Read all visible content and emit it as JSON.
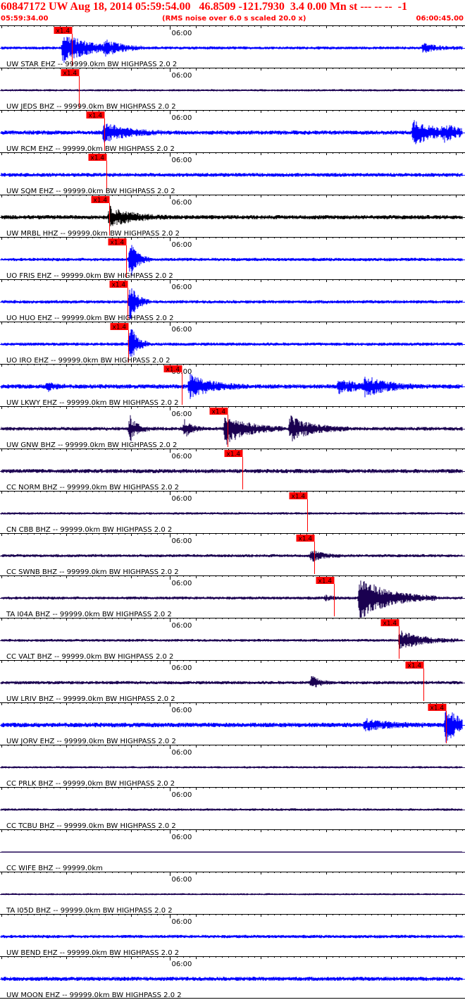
{
  "header": {
    "title": "60847172 UW Aug 18, 2014 05:59:54.00   46.8509 -121.7930  3.4 0.00 Mn st --- -- --  -1",
    "subtitle": "(RMS noise over 6.0 s scaled 20.0 x)",
    "time_start": "05:59:34.00",
    "time_end": "06:00:45.00"
  },
  "colors": {
    "blue_trace": "#0000ff",
    "dark_trace": "#1a0050",
    "black_trace": "#000000",
    "pick": "#ff0000",
    "grid": "#000000"
  },
  "chart_data": {
    "type": "line",
    "x_range_seconds": [
      0,
      71
    ],
    "minute_mark_label": "06:00",
    "minute_mark_seconds": 26,
    "pick_label": "x1.4",
    "traces": [
      {
        "label": "UW STAR EHZ -- 99999.0km BW  HIGHPASS  2.0  2",
        "color": "blue",
        "pick": 10.9,
        "noise": 2.2,
        "events": [
          {
            "t": 9.5,
            "a": 20,
            "w": 4
          },
          {
            "t": 16,
            "a": 7,
            "w": 2
          },
          {
            "t": 65,
            "a": 6,
            "w": 2
          }
        ]
      },
      {
        "label": "UW JEDS BHZ -- 99999.0km BW  HIGHPASS  2.0  2",
        "color": "dark",
        "pick": 11.9,
        "noise": 1.6,
        "events": []
      },
      {
        "label": "UW RCM EHZ -- 99999.0km BW  HIGHPASS  2.0  2",
        "color": "blue",
        "pick": 15.8,
        "noise": 3.0,
        "events": [
          {
            "t": 15.8,
            "a": 14,
            "w": 3
          },
          {
            "t": 63.5,
            "a": 18,
            "w": 3
          },
          {
            "t": 68,
            "a": 9,
            "w": 2
          }
        ]
      },
      {
        "label": "UW SQM EHZ -- 99999.0km BW  HIGHPASS  2.0  2",
        "color": "blue",
        "pick": 16.2,
        "noise": 2.8,
        "events": []
      },
      {
        "label": "UW MRBL HHZ -- 99999.0km BW  HIGHPASS  2.0  2",
        "color": "black",
        "pick": 16.6,
        "noise": 3.0,
        "events": [
          {
            "t": 16.6,
            "a": 14,
            "w": 3
          }
        ]
      },
      {
        "label": "UO FRIS EHZ -- 99999.0km BW  HIGHPASS  2.0  2",
        "color": "blue",
        "pick": 19.2,
        "noise": 2.4,
        "events": [
          {
            "t": 19.8,
            "a": 28,
            "w": 1
          }
        ]
      },
      {
        "label": "UO HUO EHZ -- 99999.0km BW  HIGHPASS  2.0  2",
        "color": "blue",
        "pick": 19.4,
        "noise": 2.4,
        "events": [
          {
            "t": 19.8,
            "a": 26,
            "w": 1
          }
        ]
      },
      {
        "label": "UO IRO EHZ -- 99999.0km BW  HIGHPASS  2.0  2",
        "color": "blue",
        "pick": 19.5,
        "noise": 2.4,
        "events": [
          {
            "t": 19.8,
            "a": 28,
            "w": 1
          }
        ]
      },
      {
        "label": "UW LKWY EHZ -- 99999.0km BW  HIGHPASS  2.0  2",
        "color": "blue",
        "pick": 27.8,
        "noise": 3.2,
        "events": [
          {
            "t": 7,
            "a": 7,
            "w": 1
          },
          {
            "t": 29,
            "a": 16,
            "w": 3
          },
          {
            "t": 52,
            "a": 9,
            "w": 3
          },
          {
            "t": 56,
            "a": 12,
            "w": 3
          }
        ]
      },
      {
        "label": "UW GNW BHZ -- 99999.0km BW  HIGHPASS  2.0  2",
        "color": "dark",
        "pick": 34.8,
        "noise": 2.6,
        "events": [
          {
            "t": 19.8,
            "a": 18,
            "w": 1
          },
          {
            "t": 28.2,
            "a": 12,
            "w": 1
          },
          {
            "t": 34.5,
            "a": 22,
            "w": 3
          },
          {
            "t": 44.5,
            "a": 18,
            "w": 3
          }
        ]
      },
      {
        "label": "CC NORM BHZ -- 99999.0km BW  HIGHPASS  2.0  2",
        "color": "dark",
        "pick": 37.1,
        "noise": 3.0,
        "events": []
      },
      {
        "label": "CN CBB BHZ -- 99999.0km BW  HIGHPASS  2.0  2",
        "color": "dark",
        "pick": 47.1,
        "noise": 1.8,
        "events": []
      },
      {
        "label": "CC SWNB BHZ -- 99999.0km BW  HIGHPASS  2.0  2",
        "color": "dark",
        "pick": 48.2,
        "noise": 2.2,
        "events": [
          {
            "t": 47.8,
            "a": 8,
            "w": 1.5
          }
        ]
      },
      {
        "label": "TA I04A BHZ -- 99999.0km BW  HIGHPASS  2.0  2",
        "color": "dark",
        "pick": 51.2,
        "noise": 2.2,
        "events": [
          {
            "t": 50,
            "a": 3,
            "w": 1
          },
          {
            "t": 55.2,
            "a": 30,
            "w": 4
          }
        ]
      },
      {
        "label": "CC VALT BHZ -- 99999.0km BW  HIGHPASS  2.0  2",
        "color": "dark",
        "pick": 61.2,
        "noise": 2.0,
        "events": [
          {
            "t": 61.4,
            "a": 14,
            "w": 3
          }
        ]
      },
      {
        "label": "UW LRIV BHZ -- 99999.0km BW  HIGHPASS  2.0  2",
        "color": "dark",
        "pick": 65.0,
        "noise": 2.4,
        "events": [
          {
            "t": 47.8,
            "a": 10,
            "w": 1
          }
        ]
      },
      {
        "label": "UW JORV EHZ -- 99999.0km BW  HIGHPASS  2.0  2",
        "color": "blue",
        "pick": 68.5,
        "noise": 3.4,
        "events": [
          {
            "t": 56,
            "a": 7,
            "w": 3
          },
          {
            "t": 68.5,
            "a": 24,
            "w": 2
          }
        ]
      },
      {
        "label": "CC PRLK BHZ -- 99999.0km BW  HIGHPASS  2.0  2",
        "color": "dark",
        "pick": null,
        "noise": 1.6,
        "events": []
      },
      {
        "label": "CC TCBU BHZ -- 99999.0km BW  HIGHPASS  2.0  2",
        "color": "dark",
        "pick": null,
        "noise": 1.8,
        "events": []
      },
      {
        "label": "CC WIFE BHZ -- 99999.0km",
        "color": "dark",
        "pick": null,
        "noise": 0,
        "events": []
      },
      {
        "label": "TA I05D BHZ -- 99999.0km BW  HIGHPASS  2.0  2",
        "color": "dark",
        "pick": null,
        "noise": 1.4,
        "events": []
      },
      {
        "label": "UW BEND EHZ -- 99999.0km BW  HIGHPASS  2.0  2",
        "color": "blue",
        "pick": null,
        "noise": 2.4,
        "events": []
      },
      {
        "label": "UW MOON EHZ -- 99999.0km BW  HIGHPASS  2.0  2",
        "color": "blue",
        "pick": null,
        "noise": 3.0,
        "events": []
      }
    ]
  }
}
